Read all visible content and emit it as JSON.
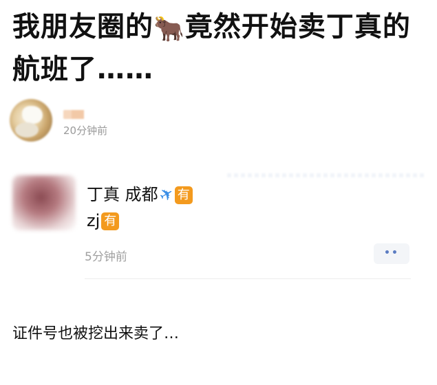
{
  "post": {
    "title_part1": "我朋友圈的",
    "title_emoji": "🐂",
    "title_part2": "竟然开始卖丁真的航班了……",
    "author_time": "20分钟前"
  },
  "comment": {
    "text_line1": "丁真  成都",
    "plane_icon": "✈",
    "badge_label": "有",
    "text_line2": "zj",
    "time": "5分钟前",
    "more_label": "••"
  },
  "caption": "证件号也被挖出来卖了…",
  "colors": {
    "badge": "#f39a1e",
    "plane": "#3a8ee6",
    "time_gray": "#9a9a9a",
    "more_dots": "#5b7cc2"
  }
}
